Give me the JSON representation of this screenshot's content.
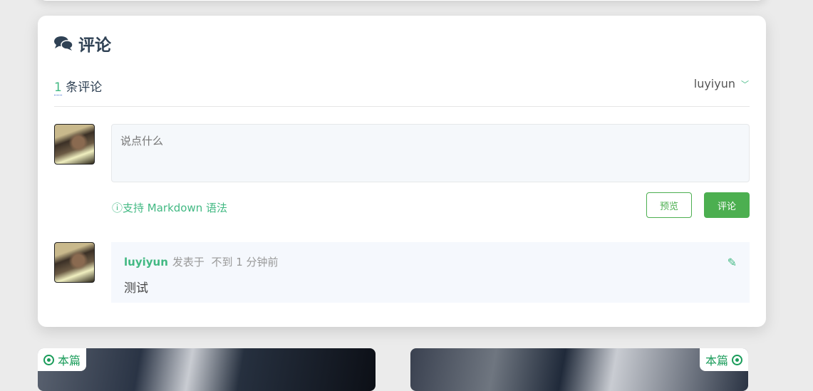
{
  "section": {
    "title": "评论",
    "icon": "comments-icon"
  },
  "summary": {
    "count": "1",
    "label": "条评论"
  },
  "user_menu": {
    "name": "luyiyun",
    "chevron": "﹀"
  },
  "editor": {
    "placeholder": "说点什么",
    "markdown_hint": "支持 Markdown 语法",
    "preview_label": "预览",
    "submit_label": "评论"
  },
  "comments": [
    {
      "author": "luyiyun",
      "posted_label": "发表于",
      "time": "不到 1 分钟前",
      "text": "测试"
    }
  ],
  "nav_cards": [
    {
      "label": "本篇"
    },
    {
      "label": "本篇"
    }
  ],
  "colors": {
    "accent": "#42b983",
    "button": "#4caf50",
    "heading": "#2f4154"
  }
}
